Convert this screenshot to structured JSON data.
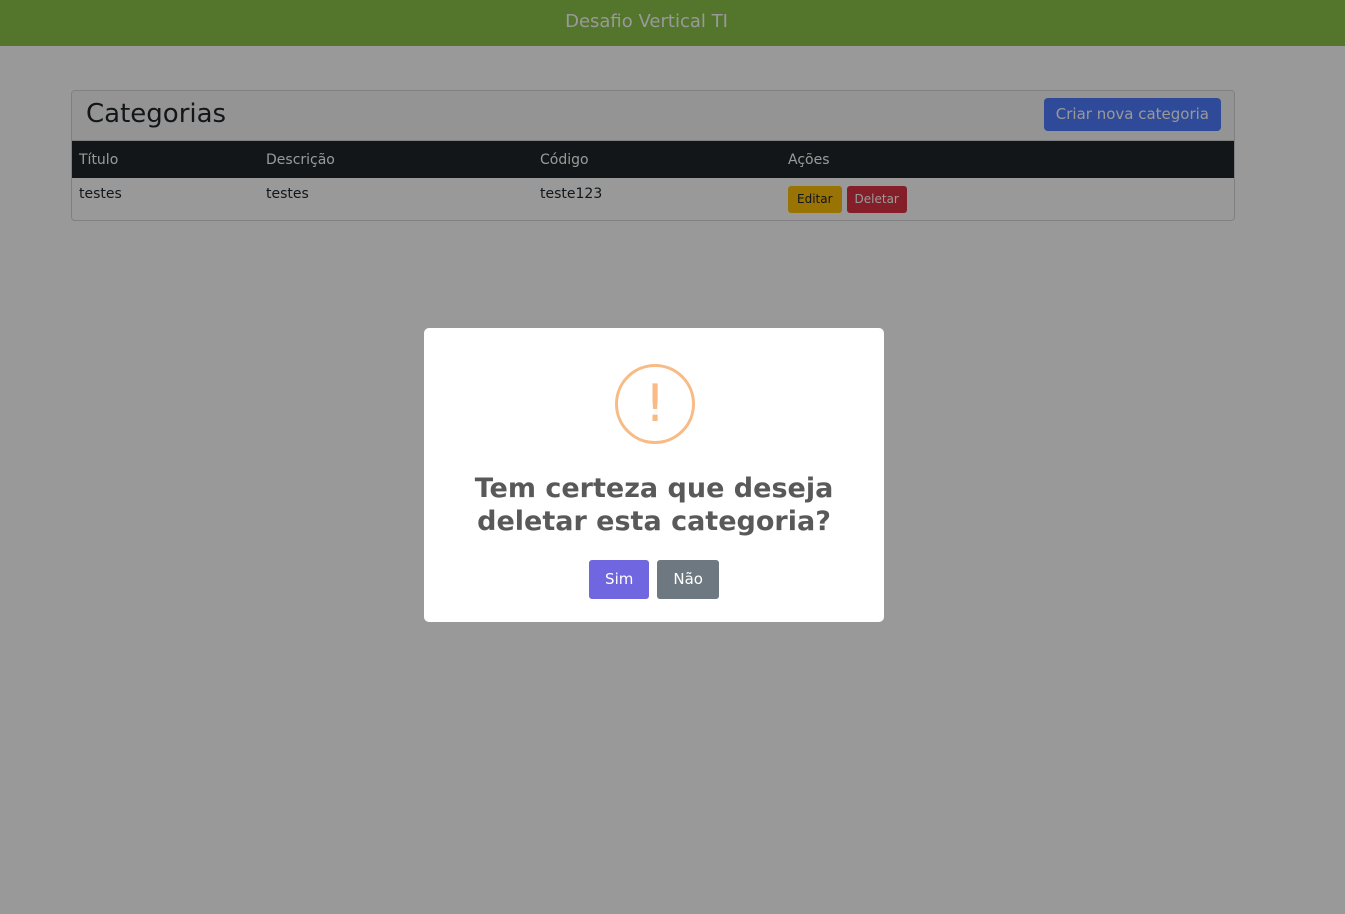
{
  "navbar": {
    "brand": "Desafio Vertical TI"
  },
  "card": {
    "title": "Categorias",
    "create_button": "Criar nova categoria"
  },
  "table": {
    "headers": [
      "Título",
      "Descrição",
      "Código",
      "Ações"
    ],
    "rows": [
      {
        "titulo": "testes",
        "descricao": "testes",
        "codigo": "teste123",
        "edit_label": "Editar",
        "delete_label": "Deletar"
      }
    ]
  },
  "modal": {
    "icon": "warning-icon",
    "icon_glyph": "!",
    "title": "Tem certeza que deseja deletar esta categoria?",
    "confirm_label": "Sim",
    "cancel_label": "Não"
  },
  "colors": {
    "navbar": "#8bc34a",
    "primary": "#4d7cff",
    "warning": "#ffc107",
    "danger": "#dc3545",
    "confirm": "#7066e0",
    "cancel": "#6e7881",
    "warning_icon": "#f8bb86"
  }
}
